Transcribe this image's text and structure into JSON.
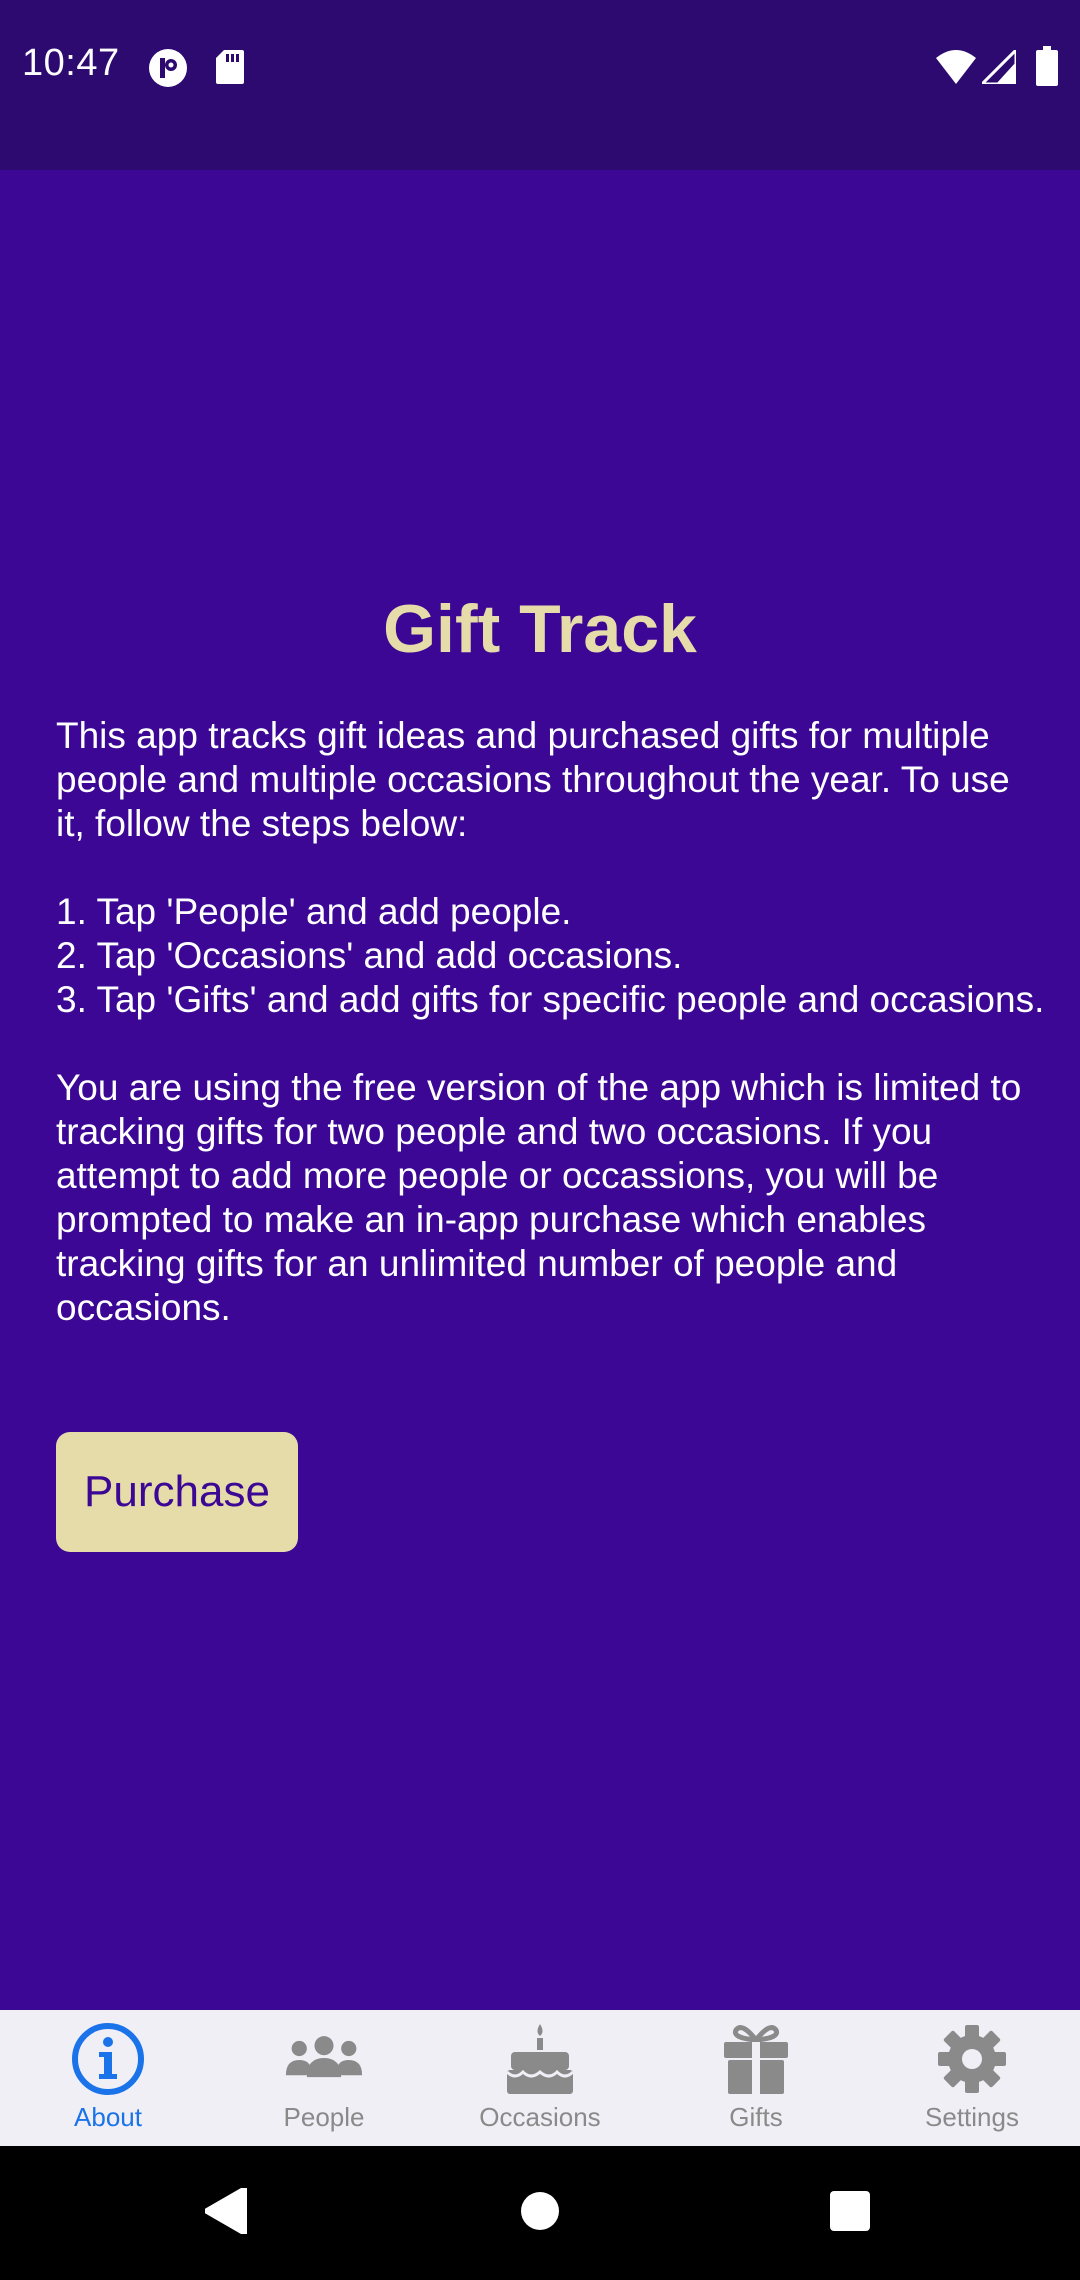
{
  "status_bar": {
    "time": "10:47"
  },
  "app": {
    "title": "Gift Track",
    "description": "This app tracks gift ideas and purchased gifts for multiple people and multiple occasions throughout the year. To use it, follow the steps below:\n\n1. Tap 'People' and add people.\n2. Tap 'Occasions' and add occasions.\n3. Tap 'Gifts' and add gifts for specific people and occasions.\n\nYou are using the free version of the app which is limited to tracking gifts for two people and two occasions. If you attempt to add more people or occassions, you will be prompted to make an in-app purchase which enables tracking gifts for an unlimited number of people and occasions.",
    "purchase_label": "Purchase"
  },
  "tabs": [
    {
      "label": "About",
      "icon": "info-icon",
      "active": true
    },
    {
      "label": "People",
      "icon": "people-icon",
      "active": false
    },
    {
      "label": "Occasions",
      "icon": "cake-icon",
      "active": false
    },
    {
      "label": "Gifts",
      "icon": "gift-icon",
      "active": false
    },
    {
      "label": "Settings",
      "icon": "gear-icon",
      "active": false
    }
  ],
  "colors": {
    "background": "#3b0794",
    "status_bar": "#2d0a70",
    "title": "#e6dcaa",
    "button": "#e6dcaa",
    "tab_active": "#1a73e8",
    "tab_inactive": "#8a8a8a"
  }
}
